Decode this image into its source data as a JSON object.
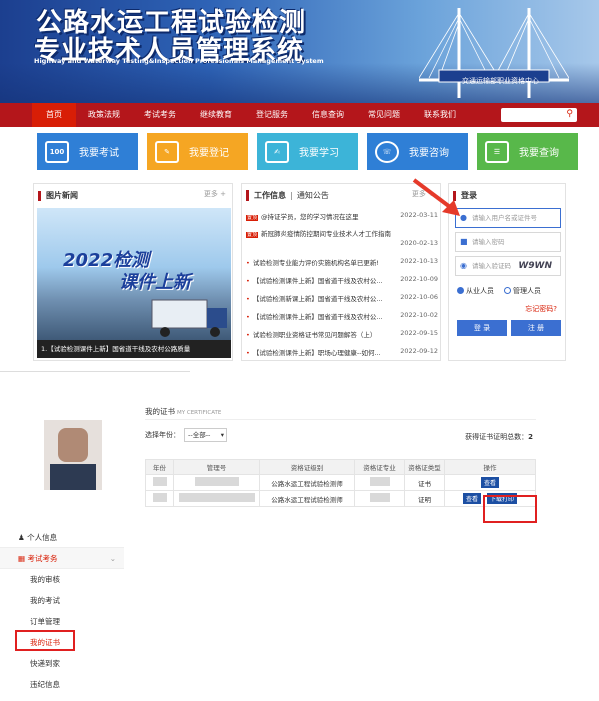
{
  "banner": {
    "title_line1": "公路水运工程试验检测",
    "title_line2": "专业技术人员管理系统",
    "title_en": "Highway and Waterway Testing&Inspection Professionals Management System",
    "badge": "交通运输部职业资格中心"
  },
  "nav": {
    "items": [
      "首页",
      "政策法规",
      "考试考务",
      "继续教育",
      "登记服务",
      "信息查询",
      "常见问题",
      "联系我们"
    ]
  },
  "tiles": [
    {
      "label": "我要考试",
      "icon": "100",
      "color": "#2f7fd6"
    },
    {
      "label": "我要登记",
      "icon": "",
      "color": "#f5a623"
    },
    {
      "label": "我要学习",
      "icon": "",
      "color": "#3cb4d8"
    },
    {
      "label": "我要咨询",
      "icon": "",
      "color": "#2f7fd6"
    },
    {
      "label": "我要查询",
      "icon": "",
      "color": "#58b84a"
    }
  ],
  "pic_news": {
    "title": "图片新闻",
    "more": "更多 +",
    "image_text1": "2022检测",
    "image_text2": "课件上新",
    "caption": "1.【试验检测课件上新】国省道干线及农村公路质量"
  },
  "news": {
    "tab1": "工作信息",
    "tab2": "通知公告",
    "more": "更多 +",
    "items": [
      {
        "tag": "置顶",
        "title": "@持证学员，您的学习情况在这里",
        "date": "2022-03-11"
      },
      {
        "tag": "置顶",
        "title": "新冠肺炎疫情防控期间专业技术人才工作指南",
        "date": "2020-02-13"
      },
      {
        "tag": "",
        "title": "试验检测专业能力评价实施机构名单已更新!",
        "date": "2022-10-13"
      },
      {
        "tag": "",
        "title": "【试验检测课件上新】国省道干线及农村公...",
        "date": "2022-10-09"
      },
      {
        "tag": "",
        "title": "【试验检测新课上新】国省道干线及农村公...",
        "date": "2022-10-06"
      },
      {
        "tag": "",
        "title": "【试验检测课件上新】国省道干线及农村公...",
        "date": "2022-10-02"
      },
      {
        "tag": "",
        "title": "试验检测职业资格证书常见问题解答（上）",
        "date": "2022-09-15"
      },
      {
        "tag": "",
        "title": "【试验检测课件上新】职场心理健康--如何...",
        "date": "2022-09-12"
      }
    ]
  },
  "login": {
    "title": "登录",
    "username_placeholder": "请输入用户名或证件号",
    "password_placeholder": "请输入密码",
    "captcha_placeholder": "请输入验证码",
    "captcha": "W9WN",
    "radio1": "从业人员",
    "radio2": "管理人员",
    "forgot": "忘记密码?",
    "login_btn": "登 录",
    "register_btn": "注 册"
  },
  "sidebar": {
    "personal": "个人信息",
    "exam": "考试考务",
    "items": [
      "我的审核",
      "我的考试",
      "订单管理",
      "我的证书",
      "快递到家",
      "违纪信息"
    ]
  },
  "certificate": {
    "title": "我的证书",
    "title_en": "MY CERTIFICATE",
    "year_label": "选择年份：",
    "year_value": "--全部--",
    "total_label": "获得证书证明总数：",
    "total": "2",
    "headers": [
      "年份",
      "管理号",
      "资格证级别",
      "资格证专业",
      "资格证类型",
      "操作"
    ],
    "rows": [
      {
        "level": "公路水运工程试验检测师",
        "type": "证书",
        "actions": [
          "查看"
        ]
      },
      {
        "level": "公路水运工程试验检测师",
        "type": "证明",
        "actions": [
          "查看",
          "下载打印"
        ]
      }
    ]
  }
}
